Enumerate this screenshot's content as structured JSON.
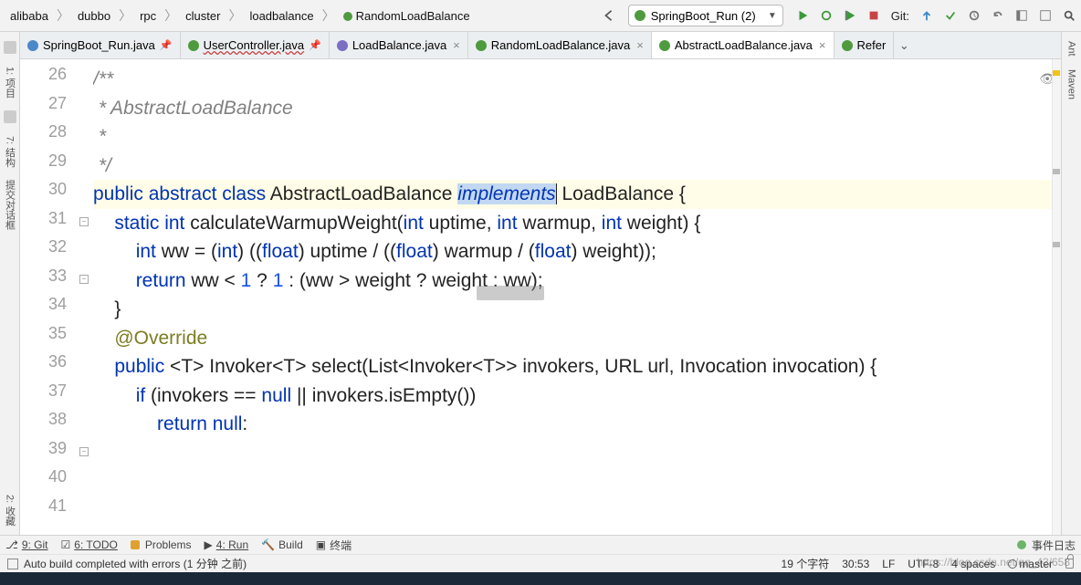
{
  "breadcrumbs": [
    "alibaba",
    "dubbo",
    "rpc",
    "cluster",
    "loadbalance",
    "RandomLoadBalance"
  ],
  "runConfig": "SpringBoot_Run (2)",
  "gitLabel": "Git:",
  "tabs": [
    {
      "label": "SpringBoot_Run.java",
      "kind": "java",
      "pinned": true
    },
    {
      "label": "UserController.java",
      "kind": "class",
      "pinned": true,
      "wavy": true
    },
    {
      "label": "LoadBalance.java",
      "kind": "int"
    },
    {
      "label": "RandomLoadBalance.java",
      "kind": "class"
    },
    {
      "label": "AbstractLoadBalance.java",
      "kind": "class",
      "active": true
    },
    {
      "label": "Refer",
      "kind": "class",
      "overflow": true
    }
  ],
  "leftTools": [
    "1: 项目",
    "7: 结构",
    "提交对话框",
    "2: 收藏"
  ],
  "rightTools": [
    "Ant",
    "Maven"
  ],
  "lines": {
    "26": "",
    "27": "/**",
    "28": " * AbstractLoadBalance",
    "29": " *",
    "30": " */",
    "31": {
      "pre": "public abstract class AbstractLoadBalance ",
      "hl": "implements",
      "post": " LoadBalance {"
    },
    "32": "",
    "33": "    static int calculateWarmupWeight(int uptime, int warmup, int weight) {",
    "34": "        int ww = (int) ((float) uptime / ((float) warmup / (float) weight));",
    "35": "        return ww < 1 ? 1 : (ww > weight ? weight : ww);",
    "36": "    }",
    "37": "",
    "38": "    @Override",
    "39": "    public <T> Invoker<T> select(List<Invoker<T>> invokers, URL url, Invocation invocation) {",
    "40": "        if (invokers == null || invokers.isEmpty())",
    "41": "            return null:"
  },
  "bottom": {
    "git": "9: Git",
    "todo": "6: TODO",
    "problems": "Problems",
    "run": "4: Run",
    "build": "Build",
    "terminal": "终端",
    "eventlog": "事件日志"
  },
  "status": {
    "msg": "Auto build completed with errors (1 分钟 之前)",
    "chars": "19 个字符",
    "pos": "30:53",
    "eol": "LF",
    "enc": "UTF-8",
    "indent": "4 spaces",
    "branch": "master"
  },
  "watermark": "https://blog.csdn.net/qq_43/658"
}
